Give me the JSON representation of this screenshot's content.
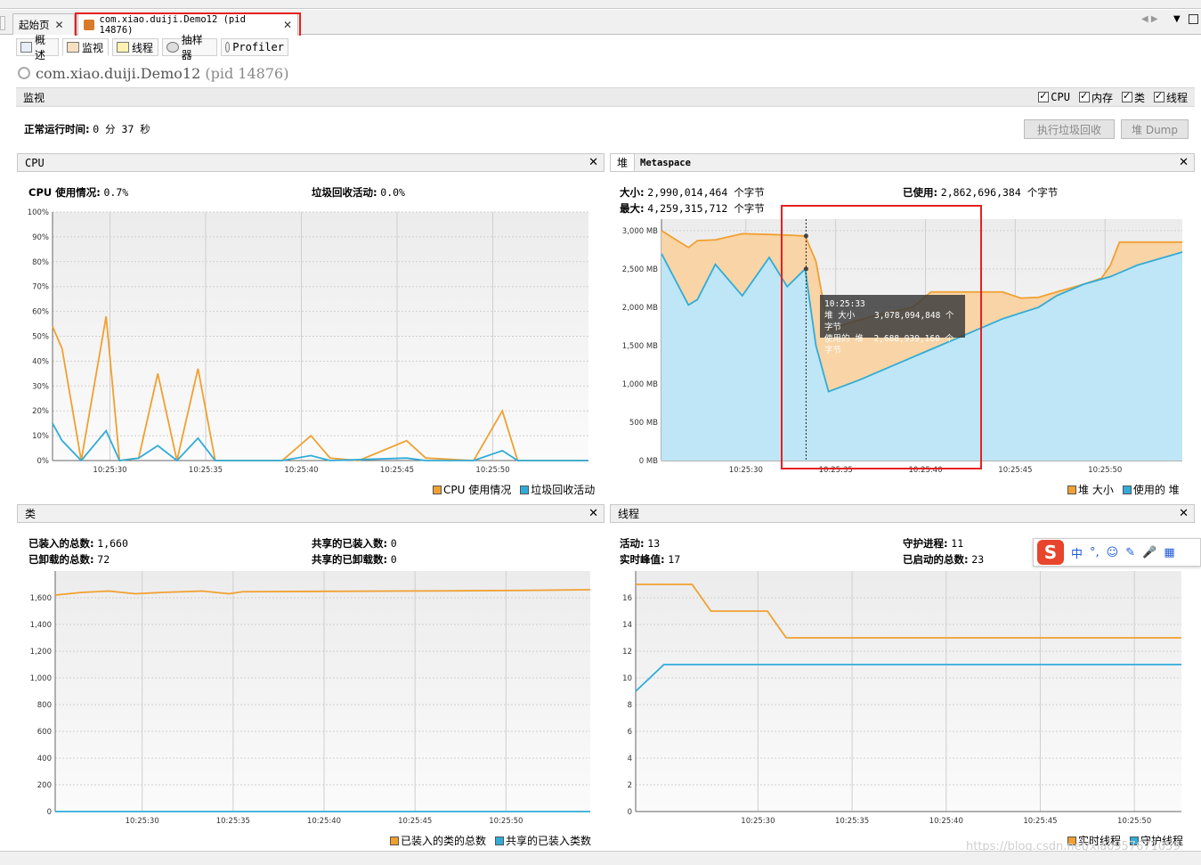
{
  "tabs": {
    "start": "起始页",
    "app": "com.xiao.duiji.Demo12 (pid 14876)"
  },
  "subtabs": [
    "概述",
    "监视",
    "线程",
    "抽样器",
    "Profiler"
  ],
  "title": {
    "name": "com.xiao.duiji.Demo12",
    "pid": "(pid 14876)"
  },
  "monitor": {
    "label": "监视",
    "checkboxes": [
      "CPU",
      "内存",
      "类",
      "线程"
    ],
    "uptime_label": "正常运行时间:",
    "uptime_value": "0 分 37 秒",
    "gc_button": "执行垃圾回收",
    "dump_button": "堆 Dump"
  },
  "cpu": {
    "header": "CPU",
    "usage_label": "CPU 使用情况:",
    "usage_value": "0.7%",
    "gc_label": "垃圾回收活动:",
    "gc_value": "0.0%"
  },
  "heap": {
    "tab_heap": "堆",
    "tab_meta": "Metaspace",
    "size_label": "大小:",
    "size_value": "2,990,014,464 个字节",
    "max_label": "最大:",
    "max_value": "4,259,315,712 个字节",
    "used_label": "已使用:",
    "used_value": "2,862,696,384 个字节",
    "tooltip": {
      "time": "10:25:33",
      "l1": "堆 大小",
      "v1": "3,078,094,848 个字节",
      "l2": "使用的 堆",
      "v2": "2,688,939,160 个字节"
    }
  },
  "classes": {
    "header": "类",
    "loaded_label": "已装入的总数:",
    "loaded_value": "1,660",
    "unloaded_label": "已卸载的总数:",
    "unloaded_value": "72",
    "shared_loaded_label": "共享的已装入数:",
    "shared_loaded_value": "0",
    "shared_unloaded_label": "共享的已卸载数:",
    "shared_unloaded_value": "0"
  },
  "threads": {
    "header": "线程",
    "live_label": "活动:",
    "live_value": "13",
    "daemon_label": "守护进程:",
    "daemon_value": "11",
    "peak_label": "实时峰值:",
    "peak_value": "17",
    "started_label": "已启动的总数:",
    "started_value": "23"
  },
  "ime": {
    "items": [
      "中",
      "°,",
      "☺",
      "✎",
      "🎤",
      "▦"
    ]
  },
  "watermark": "https://blog.csdn.net/xiao957671059",
  "colors": {
    "orange": "#f0a030",
    "blue": "#30acd8"
  },
  "chart_data": [
    {
      "type": "line",
      "name": "cpu",
      "x_ticks": [
        "10:25:30",
        "10:25:35",
        "10:25:40",
        "10:25:45",
        "10:25:50"
      ],
      "ylim": [
        0,
        100
      ],
      "y_ticks": [
        "0%",
        "10%",
        "20%",
        "30%",
        "40%",
        "50%",
        "60%",
        "70%",
        "80%",
        "90%",
        "100%"
      ],
      "legend": [
        "CPU 使用情况",
        "垃圾回收活动"
      ],
      "series": [
        {
          "name": "CPU 使用情况",
          "values": [
            [
              0,
              54
            ],
            [
              0.5,
              45
            ],
            [
              1.5,
              0
            ],
            [
              2.8,
              58
            ],
            [
              3.5,
              0
            ],
            [
              4.5,
              1
            ],
            [
              5.5,
              35
            ],
            [
              6.5,
              0
            ],
            [
              7.6,
              37
            ],
            [
              8.5,
              0
            ],
            [
              9.5,
              0
            ],
            [
              12,
              0
            ],
            [
              13.5,
              10
            ],
            [
              14.5,
              1
            ],
            [
              16,
              0
            ],
            [
              18.5,
              8
            ],
            [
              19.5,
              1
            ],
            [
              22,
              0
            ],
            [
              23.5,
              20
            ],
            [
              24.3,
              0
            ],
            [
              28,
              0
            ]
          ]
        },
        {
          "name": "垃圾回收活动",
          "values": [
            [
              0,
              15
            ],
            [
              0.5,
              8
            ],
            [
              1.5,
              0
            ],
            [
              2.8,
              12
            ],
            [
              3.5,
              0
            ],
            [
              4.5,
              1
            ],
            [
              5.5,
              6
            ],
            [
              6.5,
              0
            ],
            [
              7.6,
              9
            ],
            [
              8.5,
              0
            ],
            [
              12,
              0
            ],
            [
              13.5,
              2
            ],
            [
              14.5,
              0
            ],
            [
              18.5,
              1
            ],
            [
              19.5,
              0
            ],
            [
              22,
              0
            ],
            [
              23.5,
              4
            ],
            [
              24.3,
              0
            ],
            [
              28,
              0
            ]
          ]
        }
      ]
    },
    {
      "type": "area",
      "name": "heap",
      "x_ticks": [
        "10:25:30",
        "10:25:35",
        "10:25:40",
        "10:25:45",
        "10:25:50"
      ],
      "ylim": [
        0,
        3150
      ],
      "y_ticks": [
        "0 MB",
        "500 MB",
        "1,000 MB",
        "1,500 MB",
        "2,000 MB",
        "2,500 MB",
        "3,000 MB"
      ],
      "legend": [
        "堆 大小",
        "使用的 堆"
      ],
      "series": [
        {
          "name": "堆 大小",
          "values": [
            [
              0,
              3000
            ],
            [
              1.5,
              2780
            ],
            [
              2,
              2870
            ],
            [
              3,
              2880
            ],
            [
              4.5,
              2960
            ],
            [
              6,
              2950
            ],
            [
              7.2,
              2940
            ],
            [
              8,
              2930
            ],
            [
              8.6,
              2600
            ],
            [
              9.3,
              1700
            ],
            [
              10.5,
              1800
            ],
            [
              12,
              1900
            ],
            [
              14,
              2000
            ],
            [
              15,
              2200
            ],
            [
              17,
              2200
            ],
            [
              19,
              2200
            ],
            [
              20,
              2120
            ],
            [
              21,
              2130
            ],
            [
              22,
              2200
            ],
            [
              23.5,
              2300
            ],
            [
              24.5,
              2380
            ],
            [
              25,
              2550
            ],
            [
              25.5,
              2850
            ],
            [
              29,
              2850
            ]
          ]
        },
        {
          "name": "使用的 堆",
          "values": [
            [
              0,
              2700
            ],
            [
              1.5,
              2030
            ],
            [
              2,
              2100
            ],
            [
              3,
              2560
            ],
            [
              4.5,
              2150
            ],
            [
              6,
              2650
            ],
            [
              7,
              2270
            ],
            [
              8,
              2500
            ],
            [
              8.6,
              1500
            ],
            [
              9.3,
              900
            ],
            [
              11,
              1050
            ],
            [
              13,
              1250
            ],
            [
              14,
              1350
            ],
            [
              15,
              1450
            ],
            [
              17,
              1650
            ],
            [
              19,
              1850
            ],
            [
              21,
              2000
            ],
            [
              22,
              2150
            ],
            [
              23.5,
              2300
            ],
            [
              25,
              2400
            ],
            [
              26.5,
              2550
            ],
            [
              29,
              2720
            ]
          ]
        }
      ]
    },
    {
      "type": "line",
      "name": "classes",
      "x_ticks": [
        "10:25:30",
        "10:25:35",
        "10:25:40",
        "10:25:45",
        "10:25:50"
      ],
      "ylim": [
        0,
        1800
      ],
      "y_ticks": [
        "0",
        "200",
        "400",
        "600",
        "800",
        "1,000",
        "1,200",
        "1,400",
        "1,600"
      ],
      "legend": [
        "已装入的类的总数",
        "共享的已装入类数"
      ],
      "series": [
        {
          "name": "已装入的类的总数",
          "values": [
            [
              0,
              1620
            ],
            [
              2,
              1640
            ],
            [
              4,
              1650
            ],
            [
              6,
              1630
            ],
            [
              8,
              1640
            ],
            [
              11,
              1650
            ],
            [
              13,
              1630
            ],
            [
              14,
              1645
            ],
            [
              20,
              1648
            ],
            [
              25,
              1650
            ],
            [
              30,
              1652
            ],
            [
              35,
              1655
            ],
            [
              40,
              1660
            ]
          ]
        },
        {
          "name": "共享的已装入类数",
          "values": [
            [
              0,
              0
            ],
            [
              40,
              0
            ]
          ]
        }
      ]
    },
    {
      "type": "line",
      "name": "threads",
      "x_ticks": [
        "10:25:30",
        "10:25:35",
        "10:25:40",
        "10:25:45",
        "10:25:50"
      ],
      "ylim": [
        0,
        18
      ],
      "y_ticks": [
        "0",
        "2",
        "4",
        "6",
        "8",
        "10",
        "12",
        "14",
        "16"
      ],
      "legend": [
        "实时线程",
        "守护线程"
      ],
      "series": [
        {
          "name": "实时线程",
          "values": [
            [
              0,
              17
            ],
            [
              3,
              17
            ],
            [
              4,
              15
            ],
            [
              7,
              15
            ],
            [
              8,
              13
            ],
            [
              29,
              13
            ]
          ]
        },
        {
          "name": "守护线程",
          "values": [
            [
              0,
              9
            ],
            [
              1.5,
              11
            ],
            [
              29,
              11
            ]
          ]
        }
      ]
    }
  ]
}
